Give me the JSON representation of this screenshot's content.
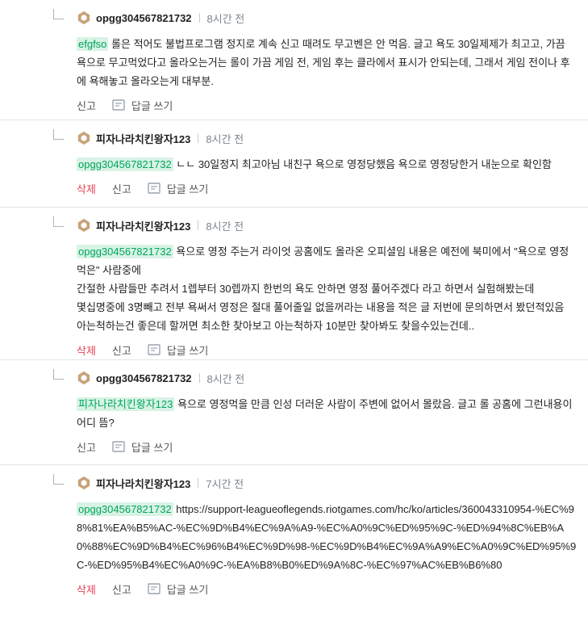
{
  "comments": [
    {
      "author": "opgg304567821732",
      "time": "8시간 전",
      "mention": "efgfso",
      "text": " 롤은 적어도 불법프로그램 정지로 계속 신고 때려도 무고벤은 안 먹음. 글고 욕도 30일제제가 최고고, 가끔 욕으로 무고먹었다고 올라오는거는 롤이 가끔 게임 전, 게임 후는 클라에서 표시가 안되는데, 그래서 게임 전이나 후에 욕해놓고 올라오는게 대부분.",
      "delete_label": "",
      "report_label": "신고",
      "reply_label": "답글 쓰기"
    },
    {
      "author": "피자나라치킨왕자123",
      "time": "8시간 전",
      "mention": "opgg304567821732",
      "text": " ㄴㄴ 30일정지 최고아님 내친구 욕으로 영정당했음 욕으로 영정당한거 내눈으로 확인함",
      "delete_label": "삭제",
      "report_label": "신고",
      "reply_label": "답글 쓰기"
    },
    {
      "author": "피자나라치킨왕자123",
      "time": "8시간 전",
      "mention": "opgg304567821732",
      "text": " 욕으로 영정 주는거 라이엇 공홈에도 올라온 오피셜임 내용은 예전에 북미에서 \"욕으로 영정먹은\" 사람중에\n간절한 사람들만 추려서 1렙부터 30렙까지 한번의 욕도 안하면 영정 풀어주겠다 라고 하면서 실험해봤는데\n몇십명중에 3명빼고 전부 욕써서 영정은 절대 풀어줄일 없을꺼라는 내용을 적은 글 저번에 문의하면서 봤던적있음\n아는척하는건 좋은데 할꺼면 최소한 찾아보고 아는척하자 10분만 찾아봐도 찾을수있는건데..",
      "delete_label": "삭제",
      "report_label": "신고",
      "reply_label": "답글 쓰기"
    },
    {
      "author": "opgg304567821732",
      "time": "8시간 전",
      "mention": "피자나라치킨왕자123",
      "text": " 욕으로 영정먹을 만큼 인성 더러운 사람이 주변에 없어서 몰랐음. 글고 롤 공홈에 그런내용이 어디 뜸?",
      "delete_label": "",
      "report_label": "신고",
      "reply_label": "답글 쓰기"
    },
    {
      "author": "피자나라치킨왕자123",
      "time": "7시간 전",
      "mention": "opgg304567821732",
      "text": " https://support-leagueoflegends.riotgames.com/hc/ko/articles/360043310954-%EC%98%81%EA%B5%AC-%EC%9D%B4%EC%9A%A9-%EC%A0%9C%ED%95%9C-%ED%94%8C%EB%A0%88%EC%9D%B4%EC%96%B4%EC%9D%98-%EC%9D%B4%EC%9A%A9%EC%A0%9C%ED%95%9C-%ED%95%B4%EC%A0%9C-%EA%B8%B0%ED%9A%8C-%EC%97%AC%EB%B6%80",
      "delete_label": "삭제",
      "report_label": "신고",
      "reply_label": "답글 쓰기"
    }
  ]
}
